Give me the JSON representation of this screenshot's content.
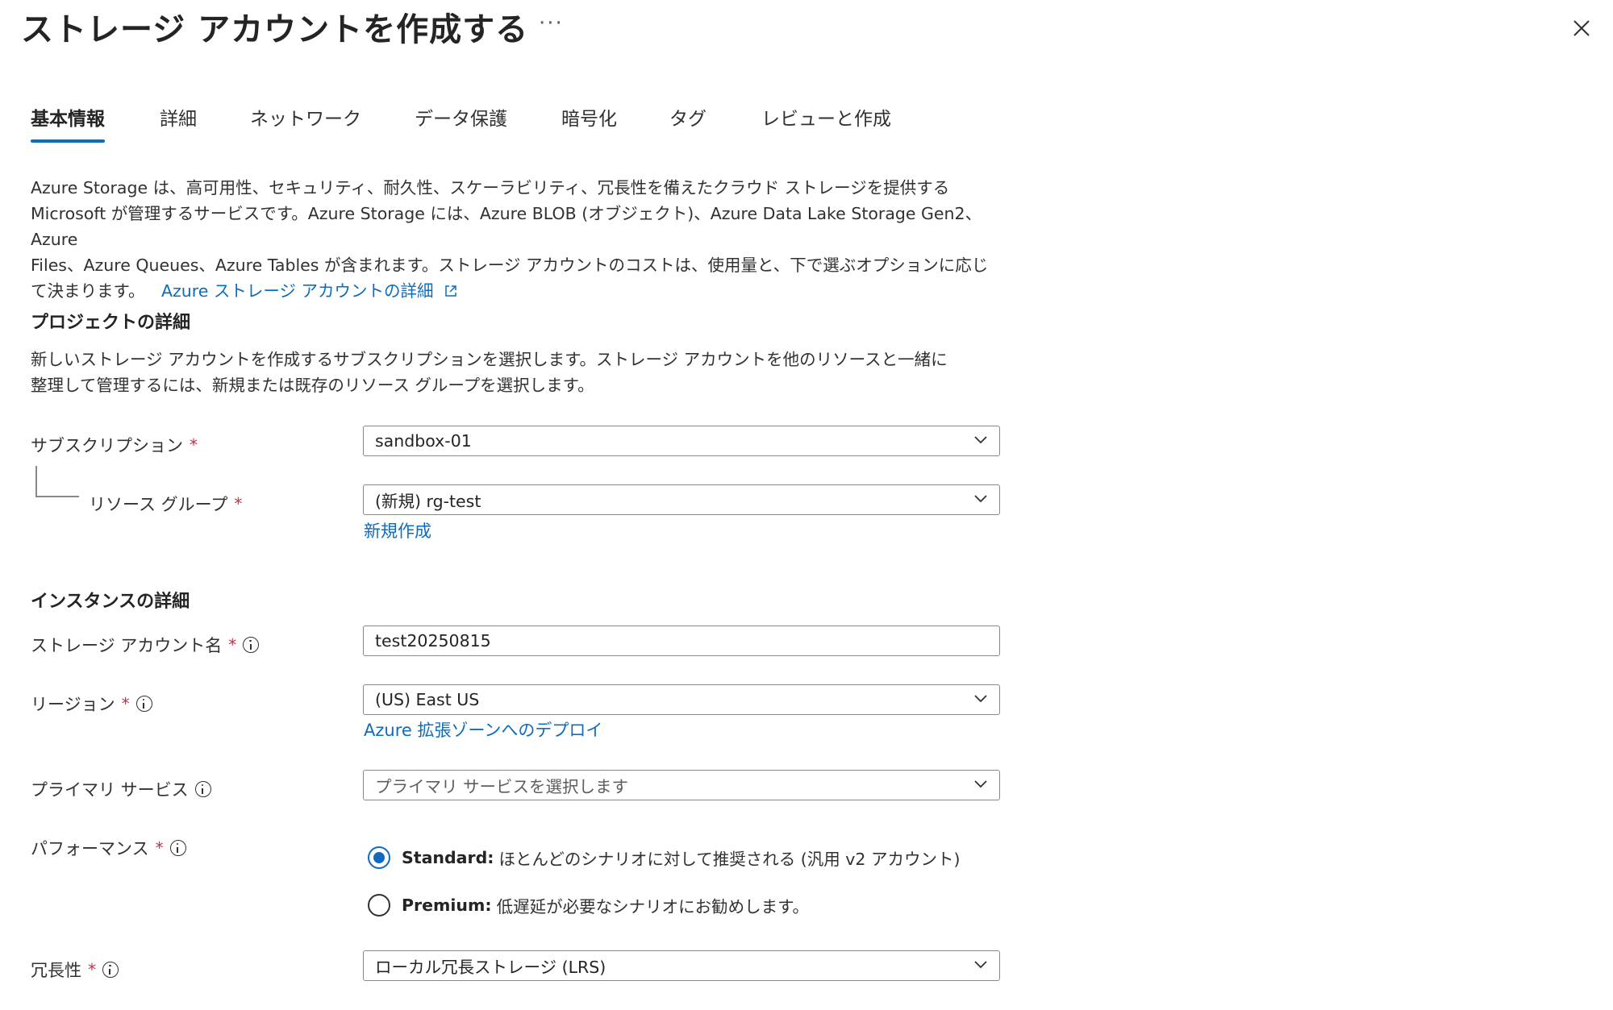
{
  "header": {
    "title": "ストレージ アカウントを作成する",
    "more": "···",
    "close_icon": "close-icon"
  },
  "tabs": [
    {
      "label": "基本情報",
      "active": true
    },
    {
      "label": "詳細",
      "active": false
    },
    {
      "label": "ネットワーク",
      "active": false
    },
    {
      "label": "データ保護",
      "active": false
    },
    {
      "label": "暗号化",
      "active": false
    },
    {
      "label": "タグ",
      "active": false
    },
    {
      "label": "レビューと作成",
      "active": false
    }
  ],
  "intro": {
    "line1": "Azure Storage は、高可用性、セキュリティ、耐久性、スケーラビリティ、冗長性を備えたクラウド ストレージを提供する",
    "line2": "Microsoft が管理するサービスです。Azure Storage には、Azure BLOB (オブジェクト)、Azure Data Lake Storage Gen2、Azure",
    "line3": "Files、Azure Queues、Azure Tables が含まれます。ストレージ アカウントのコストは、使用量と、下で選ぶオプションに応じ",
    "line4": "て決まります。",
    "link": "Azure ストレージ アカウントの詳細"
  },
  "project": {
    "heading": "プロジェクトの詳細",
    "desc_line1": "新しいストレージ アカウントを作成するサブスクリプションを選択します。ストレージ アカウントを他のリソースと一緒に",
    "desc_line2": "整理して管理するには、新規または既存のリソース グループを選択します。",
    "subscription_label": "サブスクリプション",
    "subscription_value": "sandbox-01",
    "resource_group_label": "リソース グループ",
    "resource_group_value": "(新規) rg-test",
    "create_new_link": "新規作成"
  },
  "instance": {
    "heading": "インスタンスの詳細",
    "account_name_label": "ストレージ アカウント名",
    "account_name_value": "test20250815",
    "region_label": "リージョン",
    "region_value": "(US) East US",
    "edge_zone_link": "Azure 拡張ゾーンへのデプロイ",
    "primary_service_label": "プライマリ サービス",
    "primary_service_placeholder": "プライマリ サービスを選択します",
    "performance_label": "パフォーマンス",
    "performance_options": [
      {
        "bold": "Standard:",
        "text": "ほとんどのシナリオに対して推奨される (汎用 v2 アカウント)",
        "checked": true
      },
      {
        "bold": "Premium:",
        "text": "低遅延が必要なシナリオにお勧めします。",
        "checked": false
      }
    ],
    "redundancy_label": "冗長性",
    "redundancy_value": "ローカル冗長ストレージ (LRS)"
  },
  "required_mark": "*"
}
